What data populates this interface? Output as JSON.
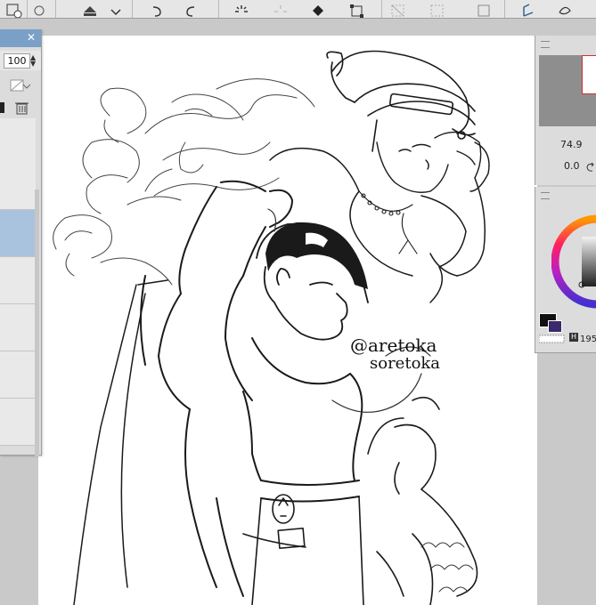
{
  "toolbar": {
    "icons": [
      "new-layer-icon",
      "export-icon",
      "dropdown-chevron-icon",
      "undo-icon",
      "redo-icon",
      "spinner-icon",
      "fill-icon",
      "transform-icon",
      "selection-icon",
      "clear-icon",
      "grid-icon",
      "layer-down-icon",
      "layer-swap-icon"
    ]
  },
  "layer_panel": {
    "opacity": "100",
    "icons": [
      "blend-mode-icon",
      "lock-icon",
      "trash-icon"
    ]
  },
  "navigator": {
    "zoom": "74.9",
    "rotation": "0.0"
  },
  "color_panel": {
    "main_color": "#111111",
    "sub_color": "#3b2a6b",
    "readout": "195"
  },
  "canvas": {
    "signature_line1": "@aretoka",
    "signature_line2": "soretoka"
  }
}
